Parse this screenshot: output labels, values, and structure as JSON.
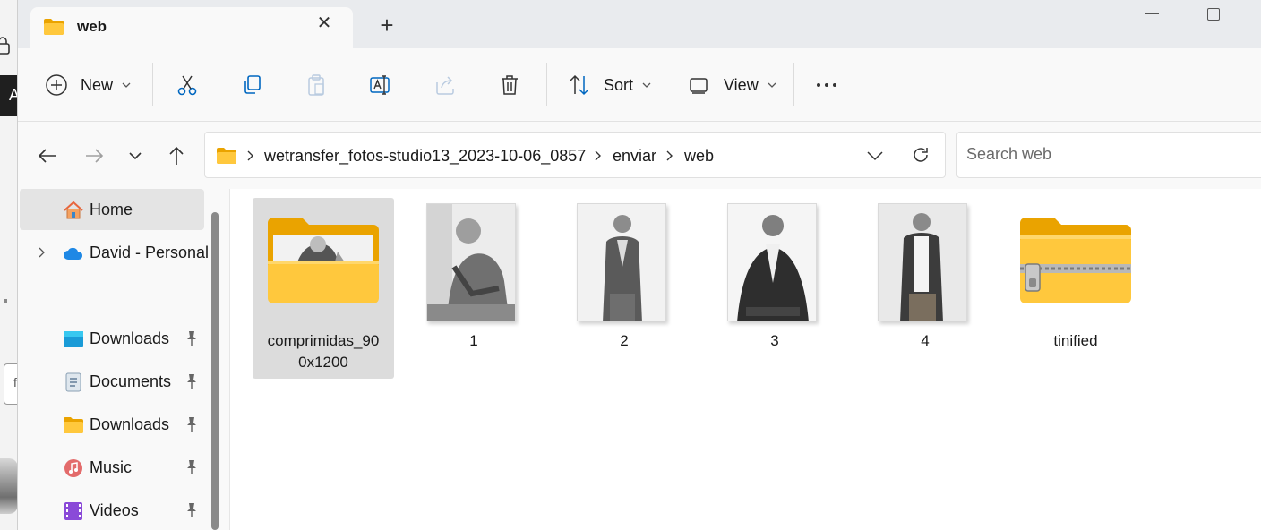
{
  "window": {
    "tab_title": "web",
    "tab_close_glyph": "✕",
    "new_tab_glyph": "+",
    "tab_icon": "folder-icon"
  },
  "toolbar": {
    "new_label": "New",
    "sort_label": "Sort",
    "view_label": "View",
    "more_glyph": "•••",
    "icons": [
      "plus-circle-icon",
      "cut-icon",
      "copy-icon",
      "paste-icon",
      "rename-icon",
      "share-icon",
      "delete-icon",
      "sort-icon",
      "view-icon",
      "more-icon"
    ]
  },
  "address": {
    "crumbs": [
      "wetransfer_fotos-studio13_2023-10-06_0857",
      "enviar",
      "web"
    ]
  },
  "search": {
    "placeholder": "Search web"
  },
  "sidebar": {
    "items": [
      {
        "label": "Home",
        "icon": "home-icon"
      },
      {
        "label": "David - Personal",
        "icon": "onedrive-icon"
      },
      {
        "label": "Downloads",
        "icon": "desktop-icon",
        "pinned": true
      },
      {
        "label": "Documents",
        "icon": "documents-icon",
        "pinned": true
      },
      {
        "label": "Downloads",
        "icon": "folder-icon",
        "pinned": true
      },
      {
        "label": "Music",
        "icon": "music-icon",
        "pinned": true
      },
      {
        "label": "Videos",
        "icon": "videos-icon",
        "pinned": true
      }
    ]
  },
  "files": [
    {
      "name": "comprimidas_900x1200",
      "type": "folder"
    },
    {
      "name": "1",
      "type": "image"
    },
    {
      "name": "2",
      "type": "image"
    },
    {
      "name": "3",
      "type": "image"
    },
    {
      "name": "4",
      "type": "image"
    },
    {
      "name": "tinified",
      "type": "zip-folder"
    }
  ],
  "colors": {
    "accent": "#0067c0",
    "folder_yellow": "#ffc83d",
    "folder_dark": "#eaa300",
    "selection": "#dcdcdc"
  }
}
